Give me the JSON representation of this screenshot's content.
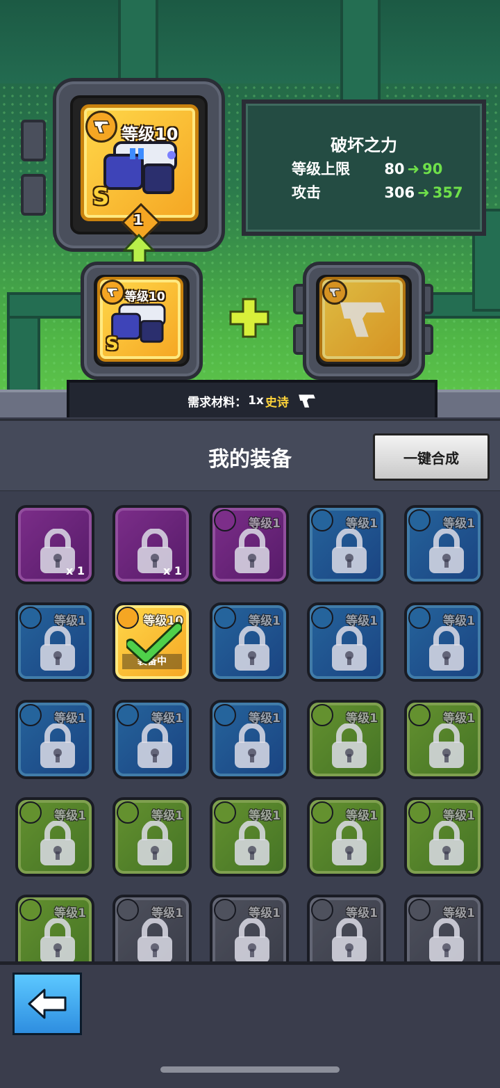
{
  "forge": {
    "result_level": "等级10",
    "result_grade": "S",
    "result_upgrade_count": "1",
    "source_level": "等级10",
    "source_grade": "S",
    "info": {
      "title": "破坏之力",
      "row1_label": "等级上限",
      "row1_from": "80",
      "row1_to": "90",
      "row2_label": "攻击",
      "row2_from": "306",
      "row2_to": "357"
    },
    "requirement": {
      "label": "需求材料：",
      "qty": "1x",
      "rarity": "史诗"
    }
  },
  "inventory": {
    "title": "我的装备",
    "combine_button": "一键合成",
    "slots": [
      {
        "rarity": "purple",
        "locked": true,
        "type": "chest",
        "level": "",
        "count": "x 1"
      },
      {
        "rarity": "purple",
        "locked": true,
        "type": "chest",
        "level": "",
        "count": "x 1"
      },
      {
        "rarity": "purple",
        "locked": true,
        "type": "item",
        "level": "等级1",
        "count": ""
      },
      {
        "rarity": "blue",
        "locked": true,
        "type": "item",
        "level": "等级1",
        "count": ""
      },
      {
        "rarity": "blue",
        "locked": true,
        "type": "item",
        "level": "等级1",
        "count": ""
      },
      {
        "rarity": "blue",
        "locked": true,
        "type": "item",
        "level": "等级1",
        "count": ""
      },
      {
        "rarity": "gold",
        "locked": false,
        "type": "equipped",
        "level": "等级10",
        "count": "",
        "equipped_label": "装备中"
      },
      {
        "rarity": "blue",
        "locked": true,
        "type": "item",
        "level": "等级1",
        "count": ""
      },
      {
        "rarity": "blue",
        "locked": true,
        "type": "item",
        "level": "等级1",
        "count": ""
      },
      {
        "rarity": "blue",
        "locked": true,
        "type": "item",
        "level": "等级1",
        "count": ""
      },
      {
        "rarity": "blue",
        "locked": true,
        "type": "item",
        "level": "等级1",
        "count": ""
      },
      {
        "rarity": "blue",
        "locked": true,
        "type": "item",
        "level": "等级1",
        "count": ""
      },
      {
        "rarity": "blue",
        "locked": true,
        "type": "item",
        "level": "等级1",
        "count": ""
      },
      {
        "rarity": "green",
        "locked": true,
        "type": "item",
        "level": "等级1",
        "count": ""
      },
      {
        "rarity": "green",
        "locked": true,
        "type": "item",
        "level": "等级1",
        "count": ""
      },
      {
        "rarity": "green",
        "locked": true,
        "type": "item",
        "level": "等级1",
        "count": ""
      },
      {
        "rarity": "green",
        "locked": true,
        "type": "item",
        "level": "等级1",
        "count": ""
      },
      {
        "rarity": "green",
        "locked": true,
        "type": "item",
        "level": "等级1",
        "count": ""
      },
      {
        "rarity": "green",
        "locked": true,
        "type": "item",
        "level": "等级1",
        "count": ""
      },
      {
        "rarity": "green",
        "locked": true,
        "type": "item",
        "level": "等级1",
        "count": ""
      },
      {
        "rarity": "green",
        "locked": true,
        "type": "item",
        "level": "等级1",
        "count": ""
      },
      {
        "rarity": "gray",
        "locked": true,
        "type": "item",
        "level": "等级1",
        "count": ""
      },
      {
        "rarity": "gray",
        "locked": true,
        "type": "item",
        "level": "等级1",
        "count": ""
      },
      {
        "rarity": "gray",
        "locked": true,
        "type": "item",
        "level": "等级1",
        "count": ""
      },
      {
        "rarity": "gray",
        "locked": true,
        "type": "item",
        "level": "等级1",
        "count": ""
      }
    ]
  },
  "colors": {
    "gold": "#f5a623",
    "green_value": "#6fe04a",
    "epic_yellow": "#ffd43a",
    "back_button": "#2e8ee0"
  },
  "icons": [
    "pistol-icon",
    "lock-icon",
    "arrow-up-icon",
    "plus-icon",
    "checkmark-icon",
    "back-arrow-icon"
  ]
}
